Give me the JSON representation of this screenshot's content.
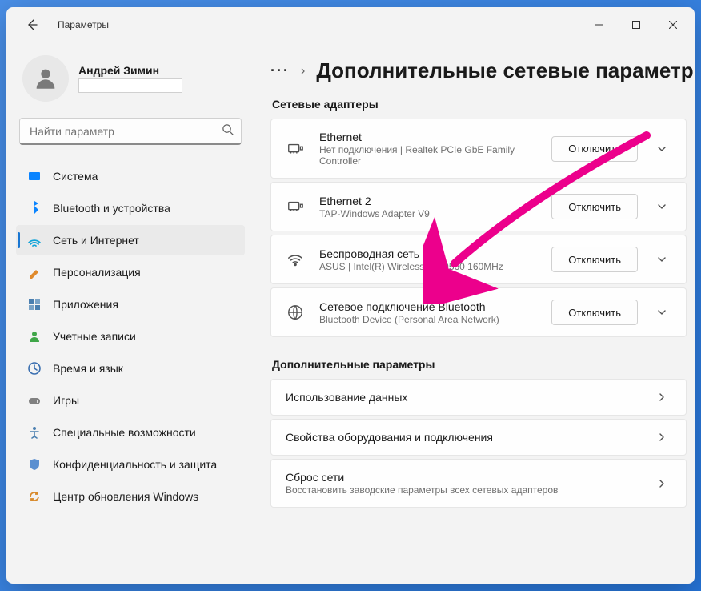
{
  "app_title": "Параметры",
  "user": {
    "name": "Андрей Зимин"
  },
  "search": {
    "placeholder": "Найти параметр"
  },
  "nav": [
    {
      "id": "system",
      "label": "Система",
      "icon": "system",
      "active": false
    },
    {
      "id": "bluetooth",
      "label": "Bluetooth и устройства",
      "icon": "bluetooth",
      "active": false
    },
    {
      "id": "network",
      "label": "Сеть и Интернет",
      "icon": "network",
      "active": true
    },
    {
      "id": "personalization",
      "label": "Персонализация",
      "icon": "personalization",
      "active": false
    },
    {
      "id": "apps",
      "label": "Приложения",
      "icon": "apps",
      "active": false
    },
    {
      "id": "accounts",
      "label": "Учетные записи",
      "icon": "accounts",
      "active": false
    },
    {
      "id": "time",
      "label": "Время и язык",
      "icon": "time",
      "active": false
    },
    {
      "id": "gaming",
      "label": "Игры",
      "icon": "gaming",
      "active": false
    },
    {
      "id": "accessibility",
      "label": "Специальные возможности",
      "icon": "accessibility",
      "active": false
    },
    {
      "id": "privacy",
      "label": "Конфиденциальность и защита",
      "icon": "privacy",
      "active": false
    },
    {
      "id": "update",
      "label": "Центр обновления Windows",
      "icon": "update",
      "active": false
    }
  ],
  "page_title": "Дополнительные сетевые параметры",
  "sections": {
    "adapters": {
      "title": "Сетевые адаптеры",
      "items": [
        {
          "title": "Ethernet",
          "subtitle": "Нет подключения | Realtek PCIe GbE Family Controller",
          "button": "Отключить",
          "icon": "ethernet"
        },
        {
          "title": "Ethernet 2",
          "subtitle": "TAP-Windows Adapter V9",
          "button": "Отключить",
          "icon": "ethernet"
        },
        {
          "title": "Беспроводная сеть",
          "subtitle": "ASUS | Intel(R) Wireless-AC 9560 160MHz",
          "button": "Отключить",
          "icon": "wifi"
        },
        {
          "title": "Сетевое подключение Bluetooth",
          "subtitle": "Bluetooth Device (Personal Area Network)",
          "button": "Отключить",
          "icon": "bt-globe"
        }
      ]
    },
    "additional": {
      "title": "Дополнительные параметры",
      "items": [
        {
          "title": "Использование данных",
          "subtitle": ""
        },
        {
          "title": "Свойства оборудования и подключения",
          "subtitle": ""
        },
        {
          "title": "Сброс сети",
          "subtitle": "Восстановить заводские параметры всех сетевых адаптеров"
        }
      ]
    }
  }
}
